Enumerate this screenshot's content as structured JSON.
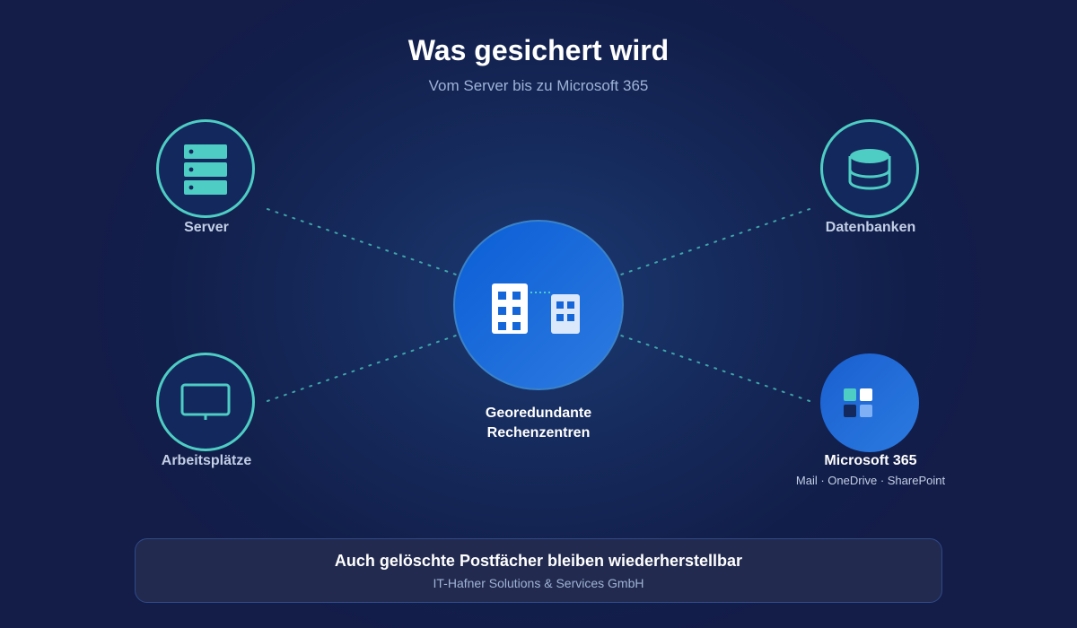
{
  "header": {
    "title": "Was gesichert wird",
    "subtitle": "Vom Server bis zu Microsoft 365"
  },
  "center": {
    "line1": "Georedundante",
    "line2": "Rechenzentren",
    "icon": "data-center-buildings-icon"
  },
  "nodes": {
    "server": {
      "label": "Server",
      "icon": "server-stack-icon"
    },
    "databases": {
      "label": "Datenbanken",
      "icon": "database-icon"
    },
    "workstations": {
      "label": "Arbeitsplätze",
      "icon": "monitor-icon"
    },
    "m365": {
      "label": "Microsoft 365",
      "sublabel": "Mail · OneDrive · SharePoint",
      "icon": "windows-tiles-icon"
    }
  },
  "banner": {
    "title": "Auch gelöschte Postfächer bleiben wiederherstellbar",
    "subtitle": "IT-Hafner Solutions & Services GmbH"
  },
  "colors": {
    "accent": "#4ecdc4",
    "primary_blue": "#1a6fe0",
    "background": "#15295a",
    "muted_text": "#9fb3d6"
  }
}
